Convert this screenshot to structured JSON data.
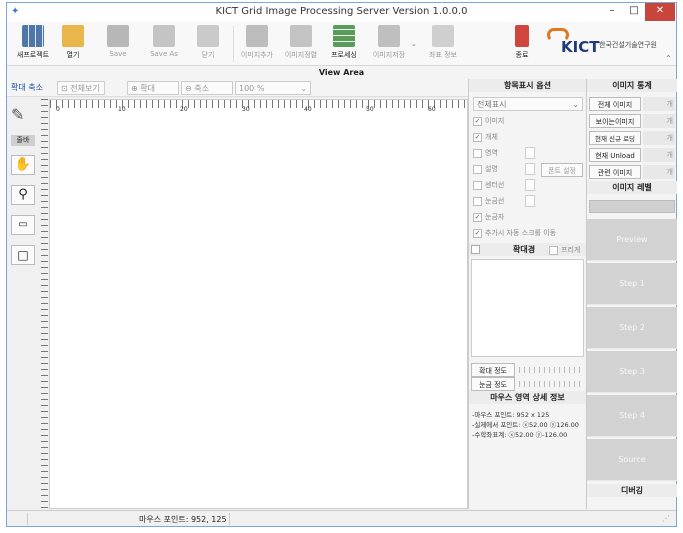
{
  "window": {
    "title": "KICT Grid Image Processing Server Version 1.0.0.0",
    "minimize": "–",
    "maximize": "□",
    "close": "✕"
  },
  "ribbon": {
    "new_project": "새프로젝트",
    "open": "열기",
    "save": "Save",
    "save_as": "Save As",
    "close": "닫기",
    "add_image": "이미지추가",
    "sort_image": "이미지정렬",
    "processing": "프로세싱",
    "save_image": "이미지저장",
    "coord_info": "좌표 정보",
    "exit": "종료",
    "logo_text": "KICT",
    "logo_sub": "한국건설기술연구원"
  },
  "view_area_label": "View Area",
  "toolbar": {
    "zoom_tab": "확대 축소",
    "fit_all": "전체보기",
    "zoom_in": "확대",
    "zoom_out": "축소",
    "zoom_value": "100 %"
  },
  "ruler_labels": [
    "0",
    "10",
    "20",
    "30",
    "40",
    "50",
    "60"
  ],
  "left_tools": {
    "label": "줄바"
  },
  "display_options": {
    "header": "항목표시 옵션",
    "select_value": "전체표시",
    "items": [
      {
        "label": "이미지",
        "checked": true
      },
      {
        "label": "개체",
        "checked": true
      },
      {
        "label": "영역",
        "checked": false
      },
      {
        "label": "설명",
        "checked": false
      },
      {
        "label": "센터선",
        "checked": false
      },
      {
        "label": "눈금선",
        "checked": false
      },
      {
        "label": "눈금자",
        "checked": true
      },
      {
        "label": "추가시 자동 스크롤 이동",
        "checked": true
      }
    ],
    "font_settings": "폰트 설정"
  },
  "magnifier": {
    "label": "확대경",
    "freeze": "프리게"
  },
  "zoom_controls": {
    "zoom_degree": "확대 정도",
    "grid_degree": "눈금 정도"
  },
  "mouse_info": {
    "header": "마우스 영역 상세 정보",
    "lines": [
      "-마우스 포인트: 952 x 125",
      "-실제에서 포인트: ⓧ52.00 ⓨ126.00",
      "-수학좌표계: ⓧ52.00 ⓨ-126.00"
    ]
  },
  "image_stats": {
    "header": "이미지 통계",
    "rows": [
      {
        "label": "전체 이미지",
        "value": "개"
      },
      {
        "label": "보이는이미지",
        "value": "개"
      },
      {
        "label": "현재 신규 로딩",
        "value": "개"
      },
      {
        "label": "현재 Unload",
        "value": "개"
      },
      {
        "label": "관련 이미지",
        "value": "개"
      }
    ],
    "level_header": "이미지 레벨"
  },
  "preview_steps": [
    "Preview",
    "Step 1",
    "Step 2",
    "Step 3",
    "Step 4",
    "Source"
  ],
  "debug_label": "디버깅",
  "status": {
    "mouse_point": "마우스 포인트: 952, 125"
  }
}
